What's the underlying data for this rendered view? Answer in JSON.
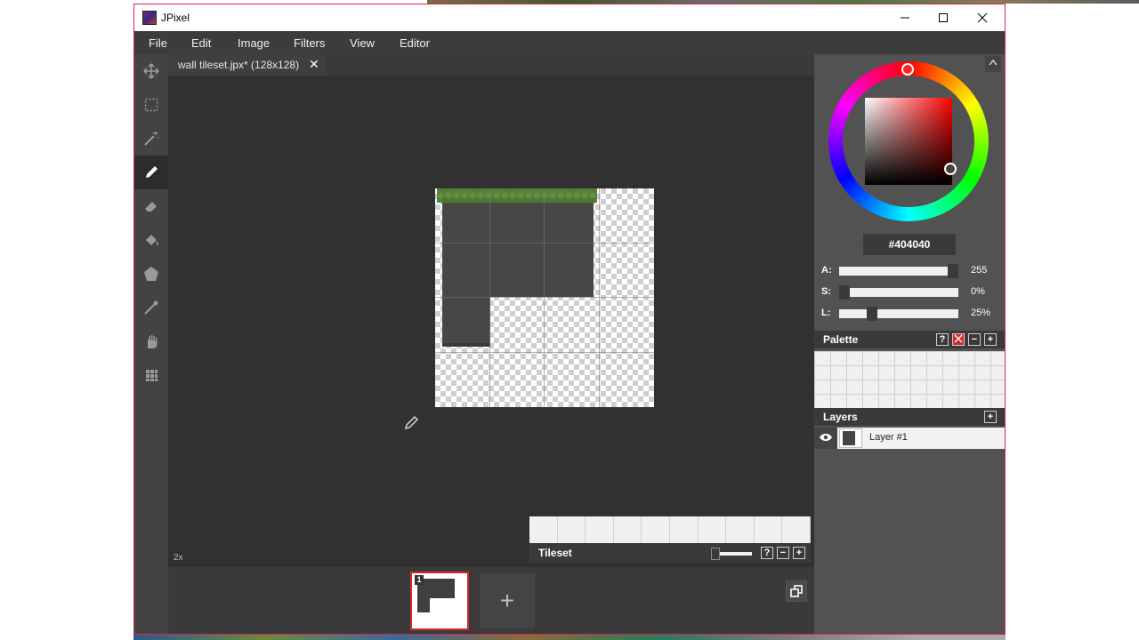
{
  "window": {
    "title": "JPixel"
  },
  "menu": [
    "File",
    "Edit",
    "Image",
    "Filters",
    "View",
    "Editor"
  ],
  "tools": [
    {
      "name": "move-icon",
      "glyph": "✥"
    },
    {
      "name": "select-rect-icon",
      "glyph": "⬚"
    },
    {
      "name": "magic-wand-icon",
      "glyph": "⁄"
    },
    {
      "name": "pencil-icon",
      "glyph": "✎",
      "active": true
    },
    {
      "name": "eraser-icon",
      "glyph": "⌫"
    },
    {
      "name": "bucket-fill-icon",
      "glyph": "◈"
    },
    {
      "name": "shape-icon",
      "glyph": "⬟"
    },
    {
      "name": "eyedropper-icon",
      "glyph": "⁄"
    },
    {
      "name": "hand-icon",
      "glyph": "✋"
    },
    {
      "name": "grid-icon",
      "glyph": "▦"
    }
  ],
  "document": {
    "tab_label": "wall tileset.jpx* (128x128)",
    "close_glyph": "✕",
    "zoom": "2x"
  },
  "tileset": {
    "label": "Tileset",
    "help": "?",
    "minus": "−",
    "plus": "+"
  },
  "frames": {
    "frame_number": "1",
    "add_glyph": "+"
  },
  "color": {
    "hex": "#404040",
    "alpha_label": "A:",
    "alpha_value": "255",
    "alpha_level": 1.0,
    "sat_label": "S:",
    "sat_value": "0%",
    "sat_level": 0.0,
    "light_label": "L:",
    "light_value": "25%",
    "light_level": 0.25
  },
  "palette": {
    "title": "Palette",
    "help": "?",
    "minus": "−",
    "plus": "+"
  },
  "layers": {
    "title": "Layers",
    "plus": "+",
    "items": [
      {
        "name": "Layer #1",
        "visible_glyph": "👁"
      }
    ]
  }
}
